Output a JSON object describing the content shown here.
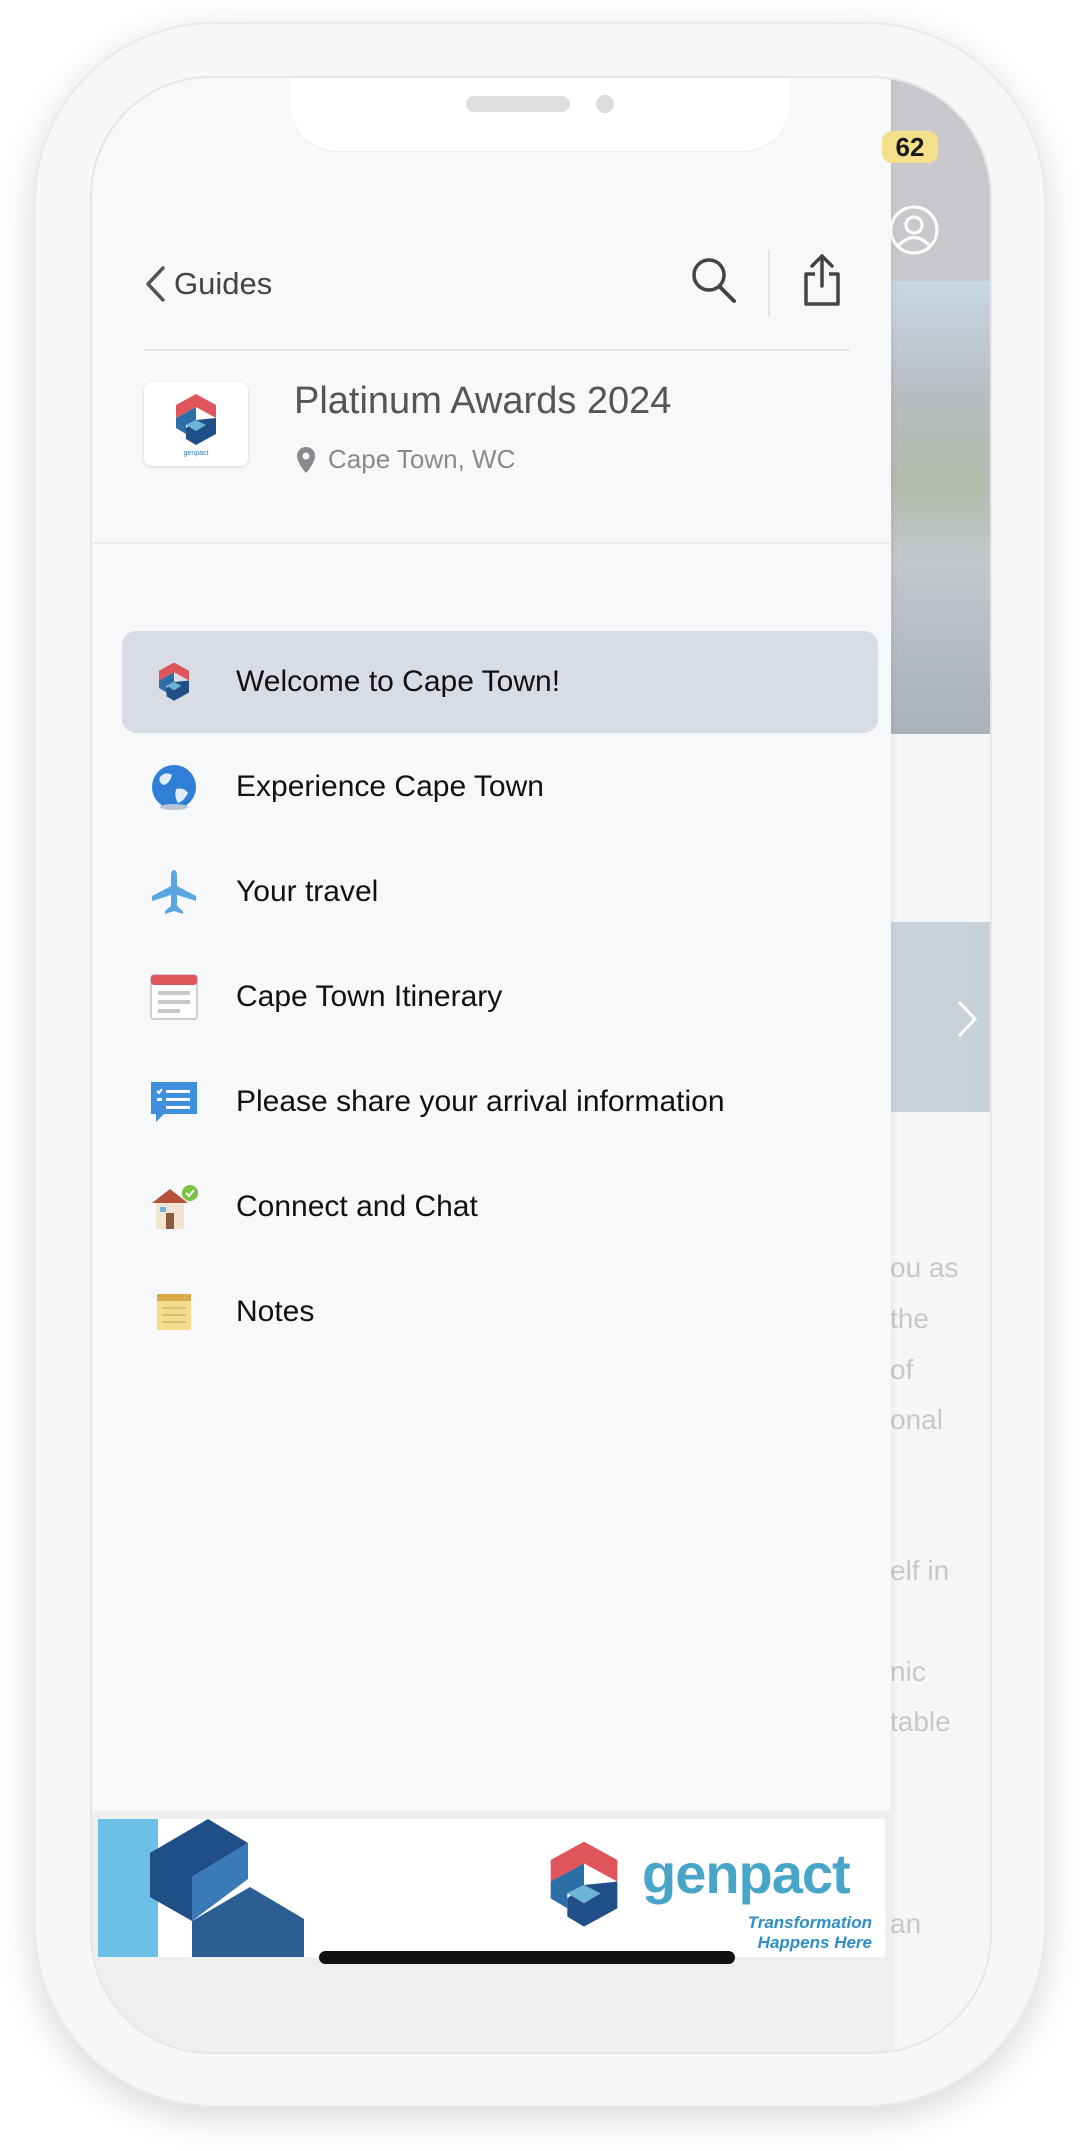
{
  "status_bar": {
    "battery": "62"
  },
  "drawer": {
    "back_label": "Guides",
    "event": {
      "title": "Platinum Awards 2024",
      "location": "Cape Town, WC",
      "logo_text": "genpact"
    },
    "menu": [
      {
        "label": "Welcome to Cape Town!",
        "icon": "genpact-logo-icon",
        "active": true
      },
      {
        "label": "Experience Cape Town",
        "icon": "globe-icon",
        "active": false
      },
      {
        "label": "Your travel",
        "icon": "airplane-icon",
        "active": false
      },
      {
        "label": "Cape Town Itinerary",
        "icon": "calendar-icon",
        "active": false
      },
      {
        "label": "Please share your arrival information",
        "icon": "form-chat-icon",
        "active": false
      },
      {
        "label": "Connect and Chat",
        "icon": "house-chat-icon",
        "active": false
      },
      {
        "label": "Notes",
        "icon": "notepad-icon",
        "active": false
      }
    ]
  },
  "banner": {
    "brand": "genpact",
    "tagline_line1": "Transformation",
    "tagline_line2": "Happens Here"
  },
  "background_page": {
    "text_fragments": [
      "ou as",
      "the",
      "of",
      "onal",
      "elf in",
      "nic",
      "table",
      "an"
    ]
  },
  "colors": {
    "drawer_bg": "#f7f8fa",
    "active_item_bg": "#d9dce5",
    "brand_red": "#e0555b",
    "brand_blue": "#2b6ea8",
    "brand_teal": "#47a5c8",
    "battery_yellow": "#f4e08a"
  }
}
